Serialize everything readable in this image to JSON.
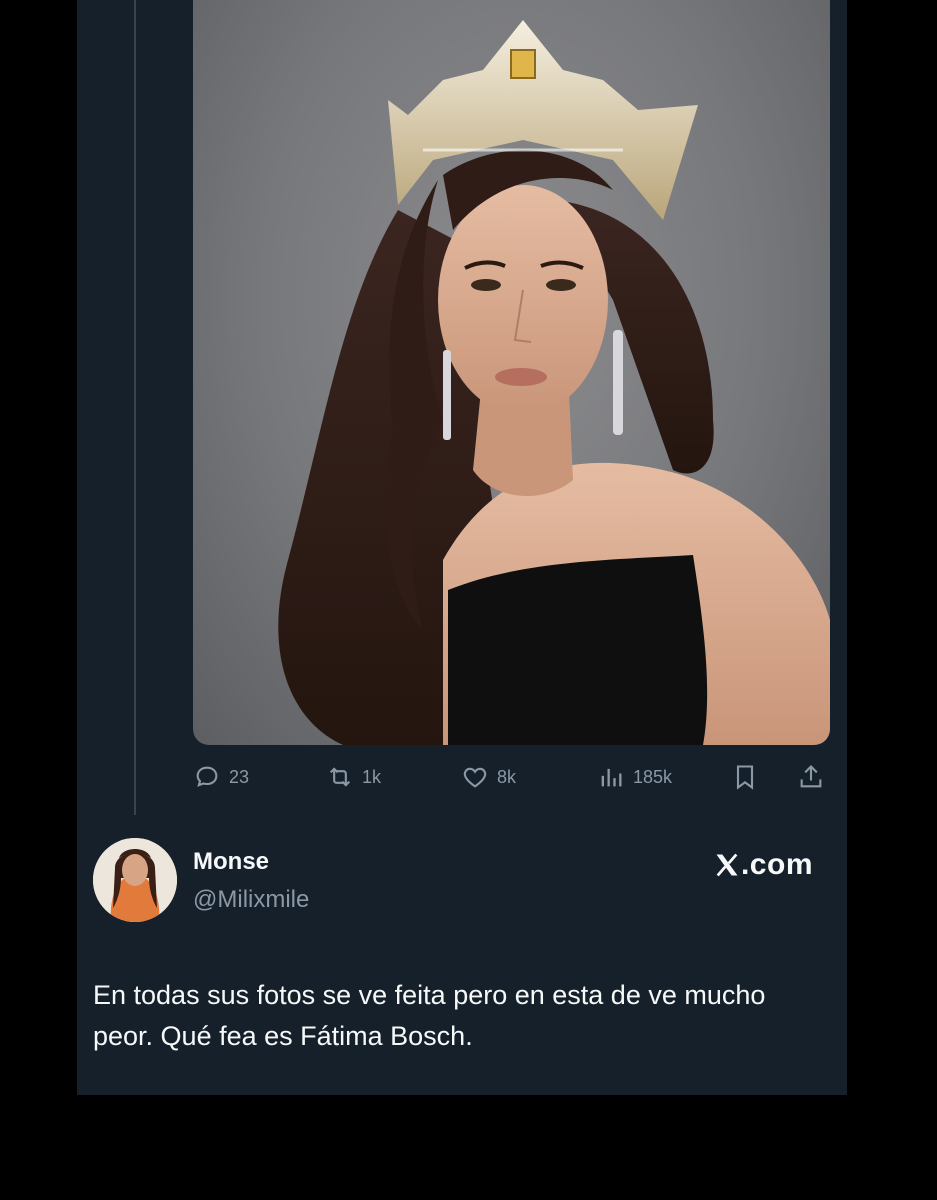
{
  "quoted_tweet": {
    "metrics": {
      "replies": "23",
      "retweets": "1k",
      "likes": "8k",
      "views": "185k"
    },
    "icons": [
      "reply-icon",
      "retweet-icon",
      "like-icon",
      "views-icon",
      "bookmark-icon",
      "share-icon"
    ]
  },
  "author": {
    "name": "Monse",
    "handle": "@Milixmile"
  },
  "brand": {
    "label": ".com",
    "logo": "x-logo-icon"
  },
  "tweet": {
    "text": "En todas sus fotos se ve feita pero en esta de ve mucho peor. Qué fea es Fátima Bosch."
  },
  "colors": {
    "background": "#000000",
    "card": "#15202b",
    "text_primary": "#f7f9f9",
    "text_secondary": "#8b98a5",
    "thread_line": "#38444d"
  }
}
